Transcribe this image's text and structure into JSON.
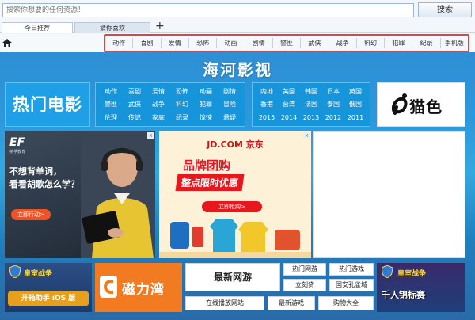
{
  "search": {
    "placeholder": "搜索你想要的任何资源！",
    "button_label": "搜索"
  },
  "tabs": [
    {
      "label": "今日推荐",
      "active": true
    },
    {
      "label": "猜你喜欢",
      "active": false
    }
  ],
  "categories": [
    "动作",
    "喜剧",
    "爱情",
    "恐怖",
    "动画",
    "剧情",
    "警匪",
    "武侠",
    "战争",
    "科幻",
    "犯罪",
    "纪录",
    "手机版"
  ],
  "site_title": "海河影视",
  "hot_movies_label": "热门电影",
  "genres": [
    "动作",
    "喜剧",
    "爱情",
    "恐怖",
    "动画",
    "剧情",
    "警匪",
    "武侠",
    "战争",
    "科幻",
    "犯罪",
    "冒险",
    "伦理",
    "传记",
    "家庭",
    "纪录",
    "惊悚",
    "悬疑"
  ],
  "regions_years": [
    "内地",
    "美国",
    "韩国",
    "日本",
    "英国",
    "香港",
    "台湾",
    "法国",
    "泰国",
    "俄国",
    "2015",
    "2014",
    "2013",
    "2012",
    "2011"
  ],
  "logo_text": "猫色",
  "ad_english": {
    "brand": "EF",
    "brand_sub": "英孚教育",
    "line1": "不想背单词，",
    "line2": "看看胡歌怎么学？",
    "button": "立即行动>"
  },
  "ad_jd": {
    "brand": "JD.COM 京东",
    "headline1": "品牌团购",
    "headline2": "整点限时优惠",
    "button": "立即抢购>"
  },
  "ad_close_glyph": "x",
  "game_ad_left": {
    "title": "皇室战争",
    "subtitle": "开箱助手 iOS 版"
  },
  "torrent_ad": {
    "text": "磁力湾"
  },
  "bottom_links": [
    "最新网游",
    "热门网游",
    "热门游戏",
    "立刻贷",
    "国安孔雀城",
    "在线播放网站",
    "最新游戏",
    "购物大全"
  ],
  "game_ad_right": {
    "title": "皇室战争",
    "subtitle": "千人锦标赛"
  },
  "colors": {
    "accent_red": "#e0443c",
    "main_blue": "#2c98dc",
    "tile_blue": "#1795da"
  }
}
